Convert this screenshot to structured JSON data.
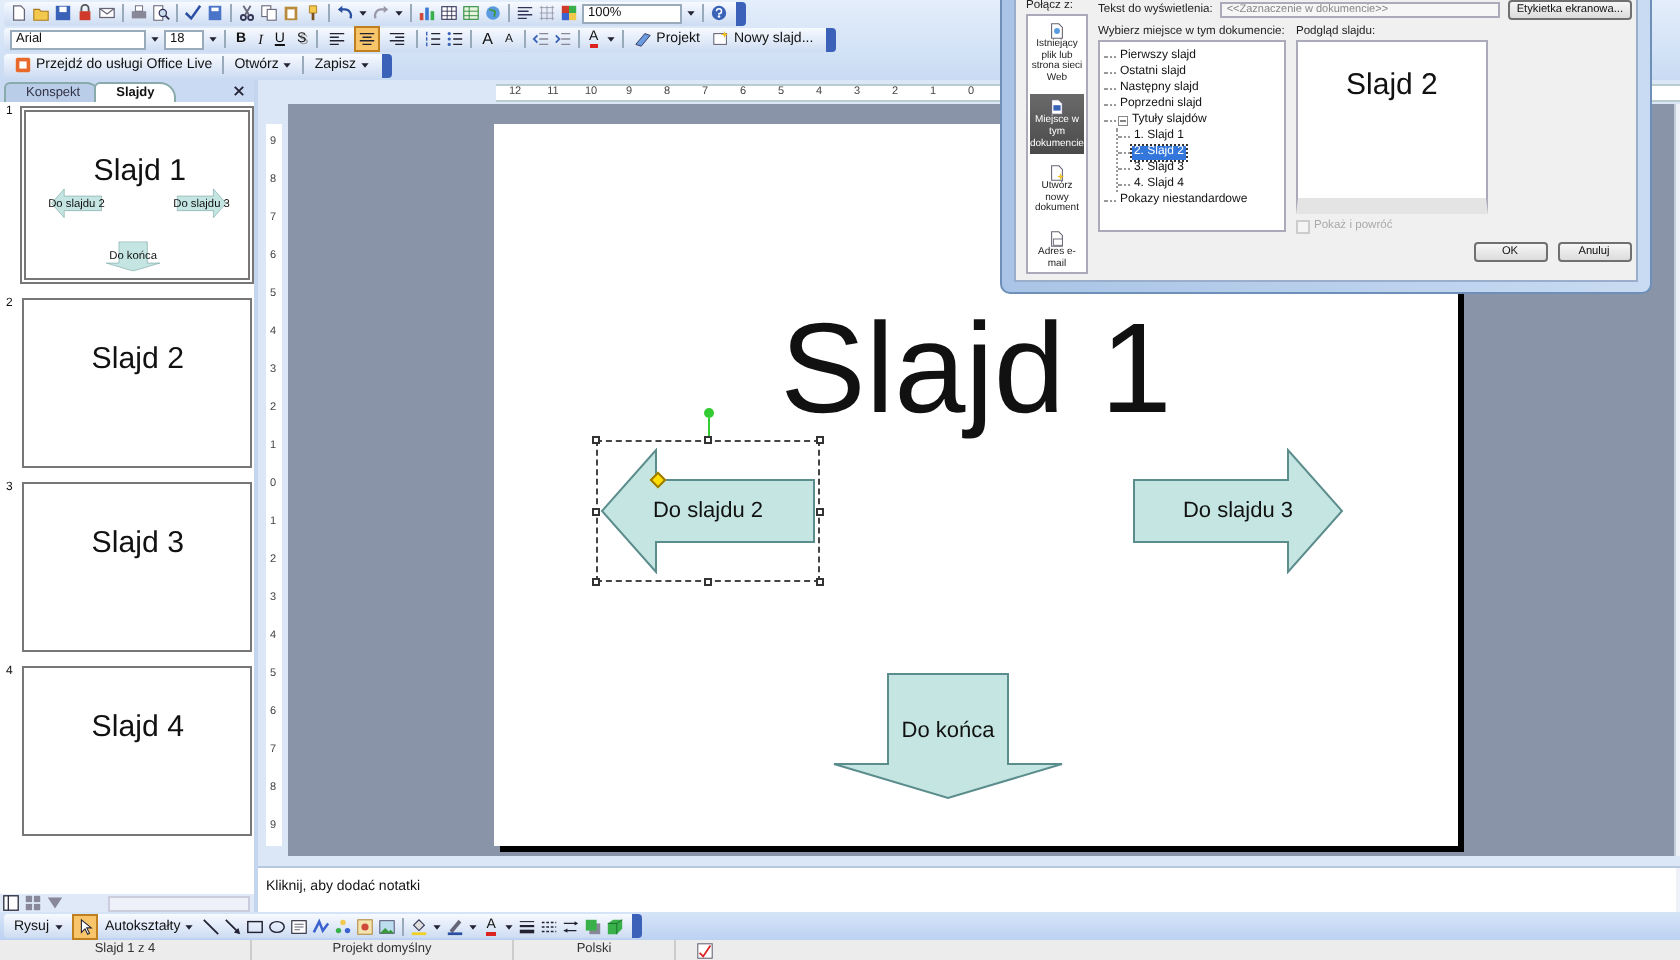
{
  "toolbars": {
    "zoom": "100%",
    "font": "Arial",
    "font_size": "18",
    "format_buttons": [
      {
        "kind": "bold",
        "label": "B"
      },
      {
        "kind": "italic",
        "label": "I"
      },
      {
        "kind": "underline",
        "label": "U"
      },
      {
        "kind": "shadow",
        "label": "S"
      }
    ],
    "alignment": [
      {
        "selected": false
      },
      {
        "selected": true
      },
      {
        "selected": false
      }
    ],
    "font_grow": "A",
    "font_shrink": "A",
    "font_color": "A",
    "design_button": "Projekt",
    "new_slide_button": "Nowy slajd...",
    "office_live_button": "Przejdź do usługi Office Live",
    "open_menu": "Otwórz",
    "save_menu": "Zapisz"
  },
  "hyperlink_dialog": {
    "link_to_label": "Połącz z:",
    "display_text_label": "Tekst do wyświetlenia:",
    "display_text_value": "<<Zaznaczenie w dokumencie>>",
    "screentip_button": "Etykietka ekranowa...",
    "places": [
      {
        "label": "Istniejący plik lub strona sieci Web",
        "selected": false
      },
      {
        "label": "Miejsce w tym dokumencie",
        "selected": true
      },
      {
        "label": "Utwórz nowy dokument",
        "selected": false
      },
      {
        "label": "Adres e-mail",
        "selected": false
      }
    ],
    "tree_label": "Wybierz miejsce w tym dokumencie:",
    "tree": [
      {
        "label": "Pierwszy slajd",
        "selected": false
      },
      {
        "label": "Ostatni slajd",
        "selected": false
      },
      {
        "label": "Następny slajd",
        "selected": false
      },
      {
        "label": "Poprzedni slajd",
        "selected": false
      },
      {
        "label": "Tytuły slajdów",
        "selected": false,
        "expanded": true,
        "children": [
          {
            "label": "1. Slajd 1",
            "selected": false
          },
          {
            "label": "2. Slajd 2",
            "selected": true
          },
          {
            "label": "3. Slajd 3",
            "selected": false
          },
          {
            "label": "4. Slajd 4",
            "selected": false
          }
        ]
      },
      {
        "label": "Pokazy niestandardowe",
        "selected": false
      }
    ],
    "preview_label": "Podgląd slajdu:",
    "preview_title": "Slajd 2",
    "show_and_return": {
      "label": "Pokaż i powróć",
      "checked": false,
      "disabled": true
    },
    "buttons": [
      "OK",
      "Anuluj"
    ]
  },
  "panel_tabs": [
    {
      "label": "Konspekt",
      "selected": false
    },
    {
      "label": "Slajdy",
      "selected": true
    }
  ],
  "thumbnails": [
    {
      "number": "1",
      "title": "Slajd 1",
      "selected": true,
      "shapes": [
        {
          "kind": "left-arrow",
          "label": "Do slajdu 2"
        },
        {
          "kind": "right-arrow",
          "label": "Do slajdu 3"
        },
        {
          "kind": "down-arrow",
          "label": "Do końca"
        }
      ]
    },
    {
      "number": "2",
      "title": "Slajd 2",
      "selected": false
    },
    {
      "number": "3",
      "title": "Slajd 3",
      "selected": false
    },
    {
      "number": "4",
      "title": "Slajd 4",
      "selected": false
    }
  ],
  "ruler": {
    "horizontal": [
      "12",
      "11",
      "10",
      "9",
      "8",
      "7",
      "6",
      "5",
      "4",
      "3",
      "2",
      "1",
      "0"
    ],
    "vertical": [
      "9",
      "8",
      "7",
      "6",
      "5",
      "4",
      "3",
      "2",
      "1",
      "0",
      "1",
      "2",
      "3",
      "4",
      "5",
      "6",
      "7",
      "8",
      "9"
    ]
  },
  "slide": {
    "title": "Slajd 1",
    "shapes": [
      {
        "kind": "left-arrow",
        "label": "Do slajdu 2",
        "selected": true
      },
      {
        "kind": "right-arrow",
        "label": "Do slajdu 3",
        "selected": false
      },
      {
        "kind": "down-arrow",
        "label": "Do końca",
        "selected": false
      }
    ]
  },
  "notes_placeholder": "Kliknij, aby dodać notatki",
  "drawing_toolbar": {
    "draw_menu": "Rysuj",
    "autoshapes_menu": "Autokształty",
    "font_color": "A"
  },
  "status_bar": [
    "Slajd 1 z 4",
    "Projekt domyślny",
    "Polski"
  ]
}
